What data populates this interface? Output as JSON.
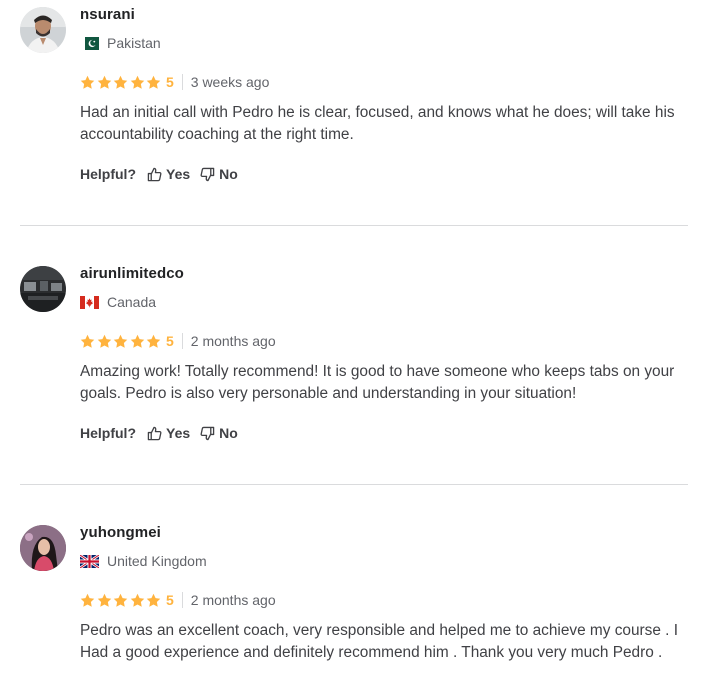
{
  "helpful_label": "Helpful?",
  "yes_label": "Yes",
  "no_label": "No",
  "star_color": "#ffb33e",
  "reviews": [
    {
      "username": "nsurani",
      "country": "Pakistan",
      "flag_icon": "pakistan-flag-icon",
      "rating": "5",
      "time": "3 weeks ago",
      "text": "Had an initial call with Pedro he is clear, focused, and knows what he does; will take his accountability coaching at the right time."
    },
    {
      "username": "airunlimitedco",
      "country": "Canada",
      "flag_icon": "canada-flag-icon",
      "rating": "5",
      "time": "2 months ago",
      "text": "Amazing work! Totally recommend! It is good to have someone who keeps tabs on your goals. Pedro is also very personable and understanding in your situation!"
    },
    {
      "username": "yuhongmei",
      "country": "United Kingdom",
      "flag_icon": "uk-flag-icon",
      "rating": "5",
      "time": "2 months ago",
      "text": "Pedro was an excellent coach, very responsible and helped me to achieve my course . I Had a good experience and definitely recommend him . Thank you very much Pedro ."
    }
  ]
}
